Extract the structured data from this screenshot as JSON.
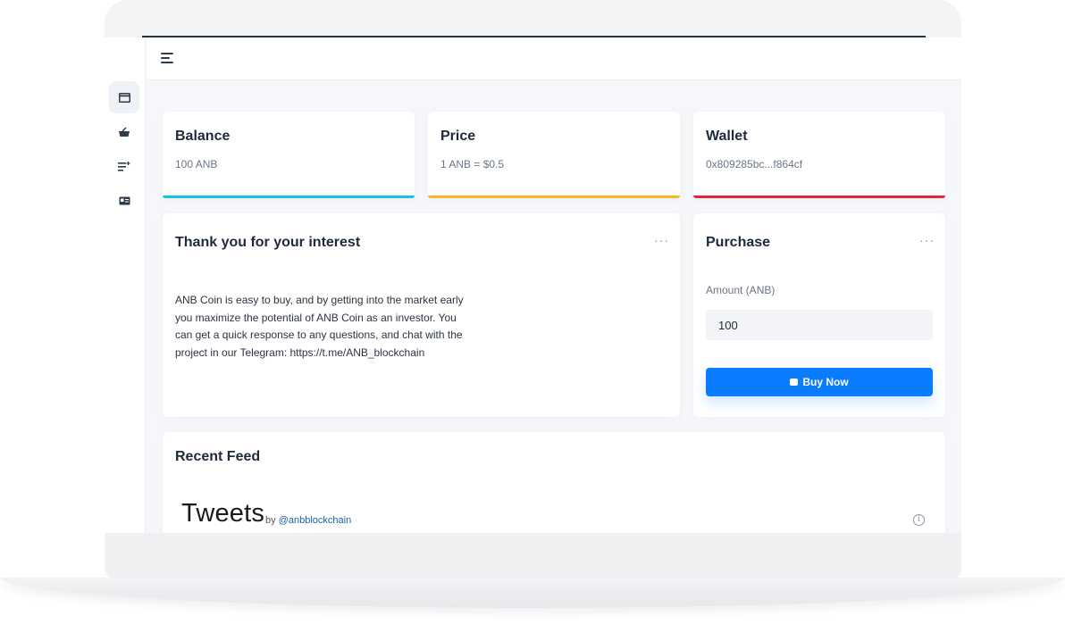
{
  "header": {
    "menu_icon": "hamburger-icon"
  },
  "sidebar": {
    "items": [
      {
        "icon": "credit-card-icon",
        "active": true
      },
      {
        "icon": "basket-icon",
        "active": false
      },
      {
        "icon": "list-plus-icon",
        "active": false
      },
      {
        "icon": "id-card-icon",
        "active": false
      }
    ]
  },
  "stats": [
    {
      "title": "Balance",
      "value": "100 ANB",
      "accent": "#17c1e8"
    },
    {
      "title": "Price",
      "value": "1 ANB = $0.5",
      "accent": "#f7b924"
    },
    {
      "title": "Wallet",
      "value": "0x809285bc...f864cf",
      "accent": "#e5273d"
    }
  ],
  "intro": {
    "title": "Thank you for your interest",
    "body": "ANB Coin is easy to buy, and by getting into the market early you maximize the potential of ANB Coin as an investor. You can get a quick response to any questions, and chat with the project in our Telegram: https://t.me/ANB_blockchain",
    "menu": "···"
  },
  "purchase": {
    "title": "Purchase",
    "menu": "···",
    "amount_label": "Amount (ANB)",
    "amount_value": "100",
    "buy_label": "Buy Now",
    "button_color": "#0a7cff"
  },
  "feed": {
    "title": "Recent Feed",
    "tweets_label": "Tweets",
    "by_label": "by",
    "handle": "@anbblockchain",
    "info_glyph": "i"
  }
}
